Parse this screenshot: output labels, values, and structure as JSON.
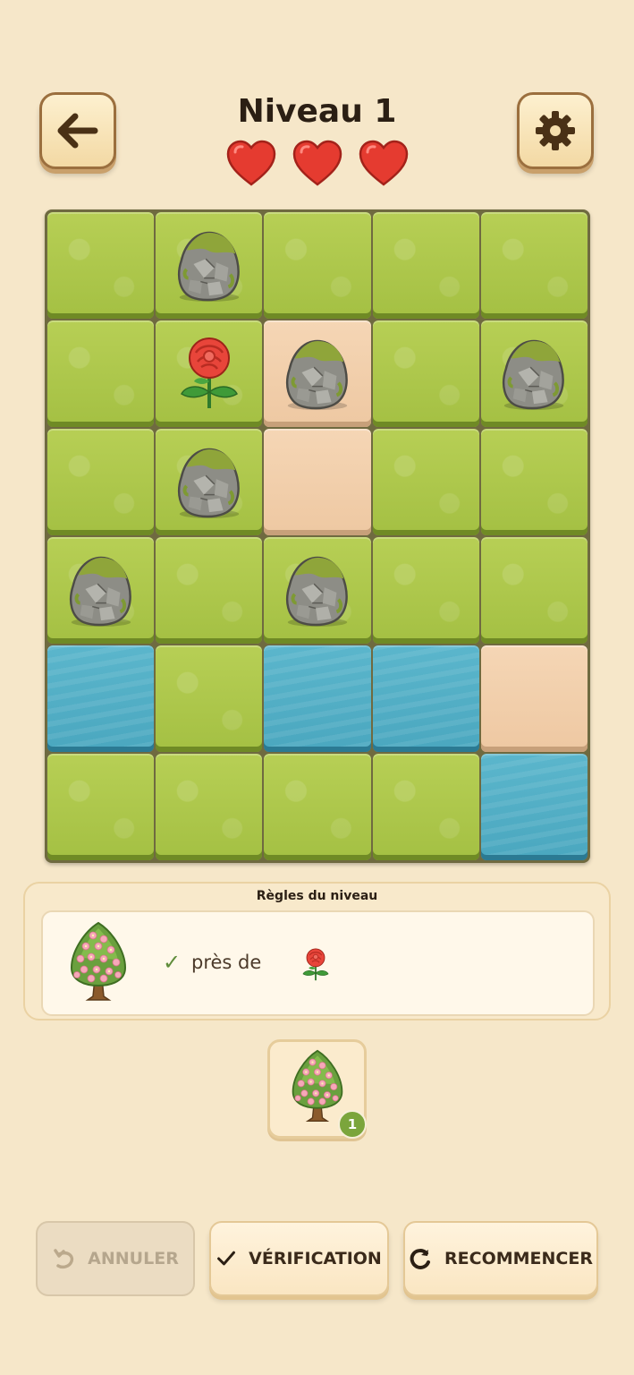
{
  "header": {
    "title": "Niveau 1",
    "lives": 3,
    "back_icon": "arrow-left-icon",
    "settings_icon": "gear-icon"
  },
  "board": {
    "columns": 5,
    "rows": [
      [
        {
          "terrain": "grass"
        },
        {
          "terrain": "grass",
          "object": "rock"
        },
        {
          "terrain": "grass"
        },
        {
          "terrain": "grass"
        },
        {
          "terrain": "grass"
        }
      ],
      [
        {
          "terrain": "grass"
        },
        {
          "terrain": "grass",
          "object": "rose"
        },
        {
          "terrain": "sand",
          "object": "rock"
        },
        {
          "terrain": "grass"
        },
        {
          "terrain": "grass",
          "object": "rock"
        }
      ],
      [
        {
          "terrain": "grass"
        },
        {
          "terrain": "grass",
          "object": "rock"
        },
        {
          "terrain": "sand"
        },
        {
          "terrain": "grass"
        },
        {
          "terrain": "grass"
        }
      ],
      [
        {
          "terrain": "grass",
          "object": "rock"
        },
        {
          "terrain": "grass"
        },
        {
          "terrain": "grass",
          "object": "rock"
        },
        {
          "terrain": "grass"
        },
        {
          "terrain": "grass"
        }
      ],
      [
        {
          "terrain": "water"
        },
        {
          "terrain": "grass"
        },
        {
          "terrain": "water"
        },
        {
          "terrain": "water"
        },
        {
          "terrain": "sand"
        }
      ],
      [
        {
          "terrain": "grass"
        },
        {
          "terrain": "grass"
        },
        {
          "terrain": "grass"
        },
        {
          "terrain": "grass"
        },
        {
          "terrain": "water"
        }
      ]
    ]
  },
  "rules": {
    "title": "Règles du niveau",
    "items": [
      {
        "subject_icon": "blossom-tree-icon",
        "check": "✓",
        "relation": "près de",
        "target_icon": "rose-icon"
      }
    ]
  },
  "inventory": {
    "items": [
      {
        "icon": "blossom-tree-icon",
        "count": "1"
      }
    ]
  },
  "actions": {
    "undo": "ANNULER",
    "check": "VÉRIFICATION",
    "restart": "RECOMMENCER"
  },
  "colors": {
    "background": "#f6e7c9",
    "grass": "#a9c448",
    "sand": "#f0cda8",
    "water": "#4fabc3",
    "heart": "#e53b30",
    "badge": "#7ba53c"
  }
}
